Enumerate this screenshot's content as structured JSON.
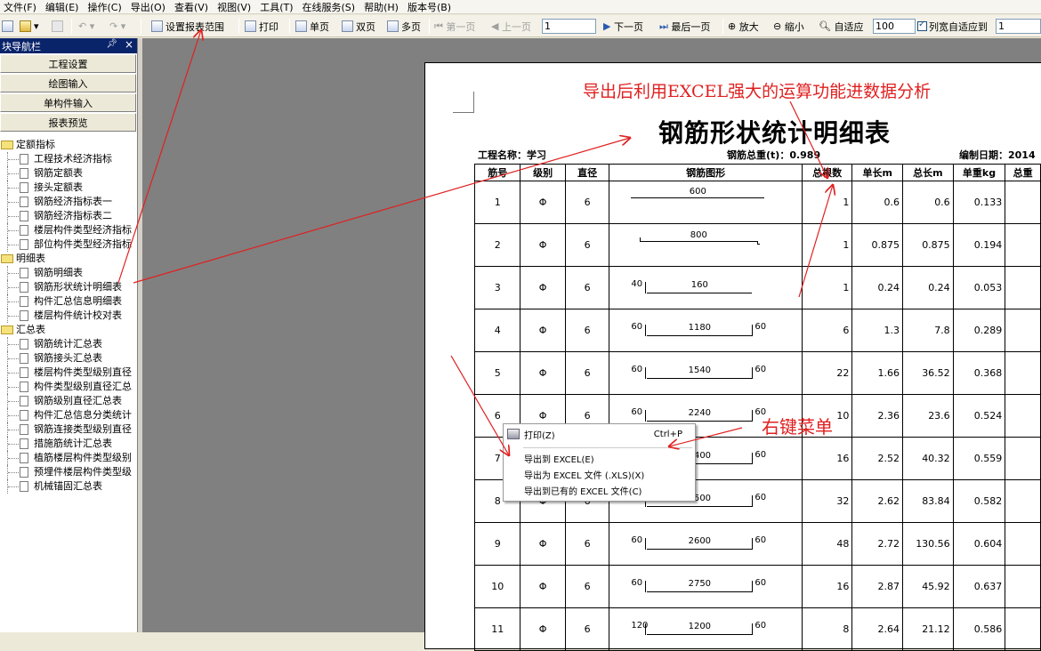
{
  "menu": [
    "文件(F)",
    "编辑(E)",
    "操作(C)",
    "导出(O)",
    "查看(V)",
    "视图(V)",
    "工具(T)",
    "在线服务(S)",
    "帮助(H)",
    "版本号(B)"
  ],
  "toolbar": {
    "set_range": "设置报表范围",
    "print": "打印",
    "single_page": "单页",
    "double_page": "双页",
    "multi_page": "多页",
    "first_page": "第一页",
    "prev_page": "上一页",
    "page_value": "1",
    "next_page": "下一页",
    "last_page": "最后一页",
    "zoom_in": "放大",
    "zoom_out": "缩小",
    "fit": "自适应",
    "zoom_value": "100",
    "col_fit_label": "列宽自适应到",
    "col_fit_value": "1"
  },
  "nav": {
    "title": "块导航栏",
    "buttons": [
      "工程设置",
      "绘图输入",
      "单构件输入",
      "报表预览"
    ],
    "tree": [
      {
        "type": "folder",
        "label": "定额指标"
      },
      {
        "type": "doc",
        "label": "工程技术经济指标"
      },
      {
        "type": "doc",
        "label": "钢筋定额表"
      },
      {
        "type": "doc",
        "label": "接头定额表"
      },
      {
        "type": "doc",
        "label": "钢筋经济指标表一"
      },
      {
        "type": "doc",
        "label": "钢筋经济指标表二"
      },
      {
        "type": "doc",
        "label": "楼层构件类型经济指标"
      },
      {
        "type": "doc",
        "label": "部位构件类型经济指标"
      },
      {
        "type": "folder",
        "label": "明细表"
      },
      {
        "type": "doc",
        "label": "钢筋明细表"
      },
      {
        "type": "doc",
        "label": "钢筋形状统计明细表"
      },
      {
        "type": "doc",
        "label": "构件汇总信息明细表"
      },
      {
        "type": "doc",
        "label": "楼层构件统计校对表"
      },
      {
        "type": "folder",
        "label": "汇总表"
      },
      {
        "type": "doc",
        "label": "钢筋统计汇总表"
      },
      {
        "type": "doc",
        "label": "钢筋接头汇总表"
      },
      {
        "type": "doc",
        "label": "楼层构件类型级别直径"
      },
      {
        "type": "doc",
        "label": "构件类型级别直径汇总"
      },
      {
        "type": "doc",
        "label": "钢筋级别直径汇总表"
      },
      {
        "type": "doc",
        "label": "构件汇总信息分类统计"
      },
      {
        "type": "doc",
        "label": "钢筋连接类型级别直径"
      },
      {
        "type": "doc",
        "label": "措施筋统计汇总表"
      },
      {
        "type": "doc",
        "label": "植筋楼层构件类型级别"
      },
      {
        "type": "doc",
        "label": "预埋件楼层构件类型级"
      },
      {
        "type": "doc",
        "label": "机械锚固汇总表"
      }
    ]
  },
  "report": {
    "title": "钢筋形状统计明细表",
    "project": "工程名称：学习",
    "total_weight": "钢筋总重(t)：0.989",
    "date": "编制日期：2014",
    "headers": [
      "筋号",
      "级别",
      "直径",
      "钢筋图形",
      "总根数",
      "单长m",
      "总长m",
      "单重kg",
      "总重"
    ],
    "rows": [
      {
        "no": "1",
        "grade": "Φ",
        "dia": "6",
        "shape": "straight",
        "l": "",
        "mid": "600",
        "r": "",
        "count": "1",
        "unit_len": "0.6",
        "total_len": "0.6",
        "unit_wt": "0.133"
      },
      {
        "no": "2",
        "grade": "Φ",
        "dia": "6",
        "shape": "hook",
        "l": "",
        "mid": "800",
        "r": "",
        "count": "1",
        "unit_len": "0.875",
        "total_len": "0.875",
        "unit_wt": "0.194"
      },
      {
        "no": "3",
        "grade": "Φ",
        "dia": "6",
        "shape": "u",
        "l": "40",
        "mid": "160",
        "r": "",
        "count": "1",
        "unit_len": "0.24",
        "total_len": "0.24",
        "unit_wt": "0.053"
      },
      {
        "no": "4",
        "grade": "Φ",
        "dia": "6",
        "shape": "u",
        "l": "60",
        "mid": "1180",
        "r": "60",
        "count": "6",
        "unit_len": "1.3",
        "total_len": "7.8",
        "unit_wt": "0.289"
      },
      {
        "no": "5",
        "grade": "Φ",
        "dia": "6",
        "shape": "u",
        "l": "60",
        "mid": "1540",
        "r": "60",
        "count": "22",
        "unit_len": "1.66",
        "total_len": "36.52",
        "unit_wt": "0.368"
      },
      {
        "no": "6",
        "grade": "Φ",
        "dia": "6",
        "shape": "u",
        "l": "60",
        "mid": "2240",
        "r": "60",
        "count": "10",
        "unit_len": "2.36",
        "total_len": "23.6",
        "unit_wt": "0.524"
      },
      {
        "no": "7",
        "grade": "Φ",
        "dia": "6",
        "shape": "u",
        "l": "60",
        "mid": "2400",
        "r": "60",
        "count": "16",
        "unit_len": "2.52",
        "total_len": "40.32",
        "unit_wt": "0.559"
      },
      {
        "no": "8",
        "grade": "Φ",
        "dia": "6",
        "shape": "u",
        "l": "60",
        "mid": "2500",
        "r": "60",
        "count": "32",
        "unit_len": "2.62",
        "total_len": "83.84",
        "unit_wt": "0.582"
      },
      {
        "no": "9",
        "grade": "Φ",
        "dia": "6",
        "shape": "u",
        "l": "60",
        "mid": "2600",
        "r": "60",
        "count": "48",
        "unit_len": "2.72",
        "total_len": "130.56",
        "unit_wt": "0.604"
      },
      {
        "no": "10",
        "grade": "Φ",
        "dia": "6",
        "shape": "u",
        "l": "60",
        "mid": "2750",
        "r": "60",
        "count": "16",
        "unit_len": "2.87",
        "total_len": "45.92",
        "unit_wt": "0.637"
      },
      {
        "no": "11",
        "grade": "Φ",
        "dia": "6",
        "shape": "u",
        "l": "120",
        "mid": "1200",
        "r": "60",
        "count": "8",
        "unit_len": "2.64",
        "total_len": "21.12",
        "unit_wt": "0.586"
      }
    ]
  },
  "context_menu": {
    "print": "打印(Z)",
    "print_shortcut": "Ctrl+P",
    "export_excel": "导出到 EXCEL(E)",
    "export_xls": "导出为 EXCEL 文件 (.XLS)(X)",
    "export_existing": "导出到已有的 EXCEL 文件(C)"
  },
  "annotations": {
    "excel_note": "导出后利用EXCEL强大的运算功能进数据分析",
    "right_click_note": "右键菜单"
  },
  "colors": {
    "annotation": "#e02020",
    "nav_title_bg": "#0a246a",
    "workspace_bg": "#808080"
  }
}
